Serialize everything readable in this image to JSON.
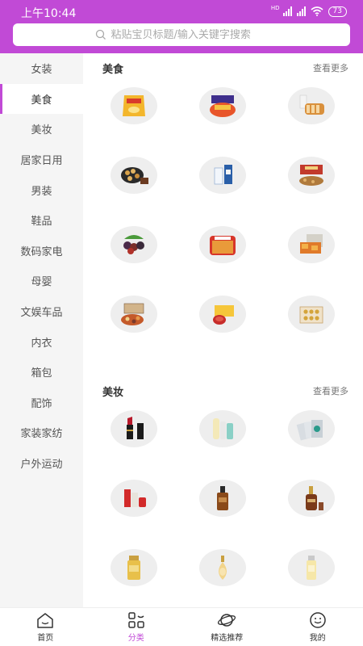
{
  "status_bar": {
    "time": "上午10:44",
    "hd_label": "HD",
    "battery": "73"
  },
  "search": {
    "placeholder": "粘贴宝贝标题/输入关键字搜索",
    "value": ""
  },
  "colors": {
    "accent": "#c14ad6",
    "sidebar_bg": "#f5f5f5",
    "thumb_bg": "#eeeeee"
  },
  "sidebar": {
    "items": [
      {
        "label": "女装"
      },
      {
        "label": "美食",
        "active": true
      },
      {
        "label": "美妆"
      },
      {
        "label": "居家日用"
      },
      {
        "label": "男装"
      },
      {
        "label": "鞋品"
      },
      {
        "label": "数码家电"
      },
      {
        "label": "母婴"
      },
      {
        "label": "文娱车品"
      },
      {
        "label": "内衣"
      },
      {
        "label": "箱包"
      },
      {
        "label": "配饰"
      },
      {
        "label": "家装家纺"
      },
      {
        "label": "户外运动"
      }
    ]
  },
  "sections": [
    {
      "title": "美食",
      "more": "查看更多",
      "items": [
        {
          "icon": "chips-bag-icon"
        },
        {
          "icon": "snack-box-icon"
        },
        {
          "icon": "bread-milk-icon"
        },
        {
          "icon": "cookie-tin-icon"
        },
        {
          "icon": "milk-carton-icon"
        },
        {
          "icon": "nut-gift-box-icon"
        },
        {
          "icon": "dried-fruit-icon"
        },
        {
          "icon": "spicy-snack-tray-icon"
        },
        {
          "icon": "crispy-rice-icon"
        },
        {
          "icon": "dried-fruit-box-icon"
        },
        {
          "icon": "mooncake-icon"
        },
        {
          "icon": "chocolate-box-icon"
        }
      ]
    },
    {
      "title": "美妆",
      "more": "查看更多",
      "items": [
        {
          "icon": "lipstick-icon"
        },
        {
          "icon": "skincare-tubes-icon"
        },
        {
          "icon": "face-mask-icon"
        },
        {
          "icon": "skincare-set-icon"
        },
        {
          "icon": "serum-bottle-icon"
        },
        {
          "icon": "essence-bottle-icon"
        },
        {
          "icon": "sunscreen-bottle-icon"
        },
        {
          "icon": "perfume-bottle-icon"
        },
        {
          "icon": "toner-bottle-icon"
        }
      ]
    }
  ],
  "tabbar": [
    {
      "label": "首页",
      "icon": "home-icon"
    },
    {
      "label": "分类",
      "icon": "category-icon",
      "active": true
    },
    {
      "label": "精选推荐",
      "icon": "planet-icon"
    },
    {
      "label": "我的",
      "icon": "smile-face-icon"
    }
  ]
}
